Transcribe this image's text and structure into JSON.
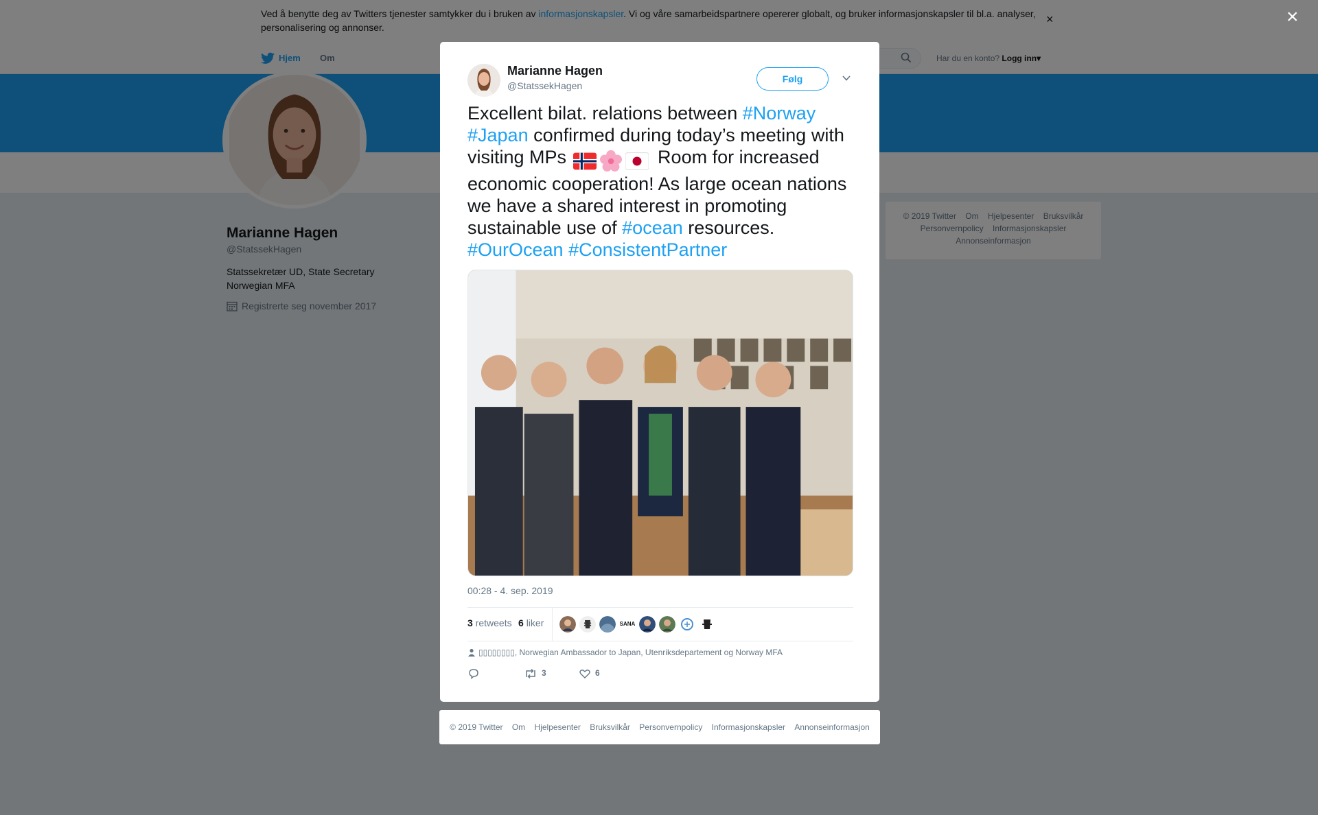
{
  "cookie_banner": {
    "text_before": "Ved å benytte deg av Twitters tjenester samtykker du i bruken av ",
    "link": "informasjonskapsler",
    "text_after": ". Vi og våre samarbeidspartnere opererer globalt, og bruker informasjonskapsler til bl.a. analyser, personalisering og annonser.",
    "close": "×"
  },
  "nav": {
    "home": "Hjem",
    "about": "Om",
    "account_prompt": "Har du en konto?",
    "login": "Logg inn",
    "login_caret": "▾"
  },
  "profile": {
    "name": "Marianne Hagen",
    "handle": "@StatssekHagen",
    "bio": "Statssekretær UD, State Secretary Norwegian MFA",
    "joined": "Registrerte seg november 2017"
  },
  "side_footer": {
    "links": [
      "© 2019 Twitter",
      "Om",
      "Hjelpesenter",
      "Bruksvilkår",
      "Personvernpolicy",
      "Informasjonskapsler",
      "Annonseinformasjon"
    ]
  },
  "overlay_close": "×",
  "tweet": {
    "name": "Marianne Hagen",
    "handle": "@StatssekHagen",
    "follow": "Følg",
    "text": {
      "p1": "Excellent bilat. relations between ",
      "h1": "#Norway",
      "h2": "#Japan",
      "p2": " confirmed during today’s meeting with visiting MPs ",
      "p3": " Room for increased economic cooperation! As large ocean nations we have a shared interest in promoting sustainable use of ",
      "h3": "#ocean",
      "p4": " resources. ",
      "h4": "#OurOcean",
      "h5": "#ConsistentPartner"
    },
    "emojis": [
      "norway-flag-icon",
      "cherry-blossom-icon",
      "japan-flag-icon"
    ],
    "timestamp": "00:28 - 4. sep. 2019",
    "retweets_count": "3",
    "retweets_label": "retweets",
    "likes_count": "6",
    "likes_label": "liker",
    "sana_label": "SANA",
    "mentions": "▯▯▯▯▯▯▯▯, Norwegian Ambassador to Japan, Utenriksdepartement og Norway MFA",
    "actions": {
      "reply_count": "",
      "retweet_count": "3",
      "like_count": "6"
    }
  },
  "modal_footer": {
    "links": [
      "© 2019 Twitter",
      "Om",
      "Hjelpesenter",
      "Bruksvilkår",
      "Personvernpolicy",
      "Informasjonskapsler",
      "Annonseinformasjon"
    ]
  },
  "colors": {
    "accent": "#1da1f2",
    "text": "#14171a",
    "secondary": "#657786",
    "background": "#e6ecf0"
  }
}
